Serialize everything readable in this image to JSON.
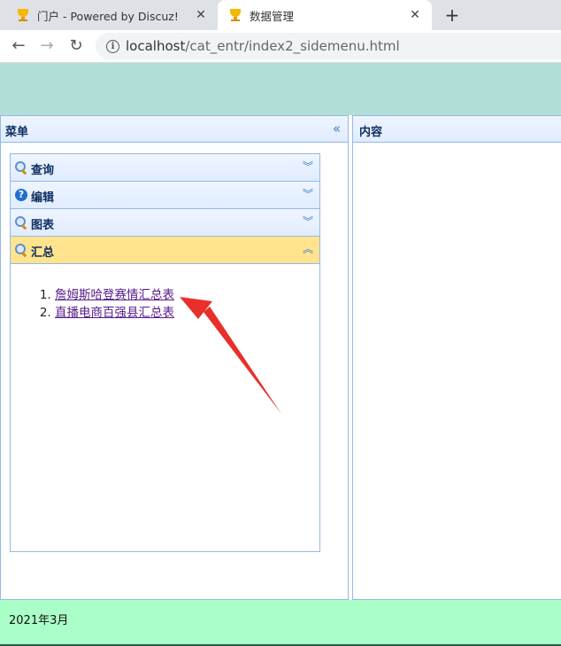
{
  "browser": {
    "tabs": [
      {
        "title": "门户 - Powered by Discuz!",
        "close": "✕"
      },
      {
        "title": "数据管理",
        "close": "✕"
      }
    ],
    "new_tab": "+",
    "nav": {
      "back": "←",
      "forward": "→",
      "reload": "↻"
    },
    "url_host": "localhost",
    "url_path": "/cat_entr/index2_sidemenu.html"
  },
  "west_panel": {
    "title": "菜单",
    "collapse": "«",
    "accordion": [
      {
        "label": "查询",
        "icon": "search-icon",
        "state": "collapsed",
        "tool": "︾"
      },
      {
        "label": "编辑",
        "icon": "help-icon",
        "state": "collapsed",
        "tool": "︾"
      },
      {
        "label": "图表",
        "icon": "search-icon",
        "state": "collapsed",
        "tool": "︾"
      },
      {
        "label": "汇总",
        "icon": "search-icon",
        "state": "expanded",
        "tool": "︽"
      }
    ],
    "summary_links": [
      "詹姆斯哈登赛情汇总表",
      "直播电商百强县汇总表"
    ]
  },
  "east_panel": {
    "title": "内容"
  },
  "footer": {
    "text": "2021年3月"
  },
  "colors": {
    "header_bg": "#b2ded8",
    "footer_bg": "#aaffc8",
    "active_item_bg": "#ffe48d",
    "border": "#95b8e7",
    "arrow": "#e8302a"
  }
}
